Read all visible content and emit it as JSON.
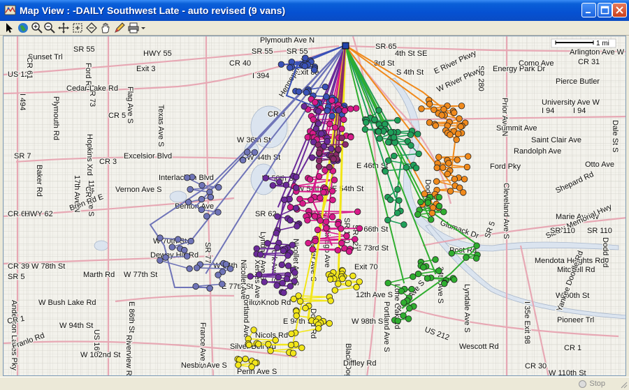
{
  "window": {
    "title": "Map View : -DAILY Southwest Late - auto revised (9 vans)"
  },
  "toolbar": {
    "tools": [
      "pointer-icon",
      "globe-icon",
      "zoom-in-icon",
      "zoom-out-icon",
      "pan-icon",
      "zoom-extent-icon",
      "zoom-previous-icon",
      "hand-icon",
      "draw-pencil-icon",
      "print-icon"
    ]
  },
  "scale": {
    "label": "1 mi"
  },
  "status": {
    "stop_label": "Stop"
  },
  "colors": {
    "blue": "#3a52b8",
    "magenta": "#d81a8a",
    "purple": "#6b2a9a",
    "slate": "#6f74b8",
    "orange": "#f08a1c",
    "green": "#1fa05a",
    "lime": "#2fae2f",
    "yellow": "#f2e61a",
    "depot": "#2244aa"
  },
  "map": {
    "labels": [
      "Plymouth Ave N",
      "Sunset Trl",
      "SR 55",
      "HWY 55",
      "SR 55",
      "SR 55",
      "CR 40",
      "I 394",
      "Exit 8a",
      "SR 65",
      "4th St SE",
      "Arlington Ave W",
      "US 12",
      "CR 61",
      "Ford Rd",
      "Exit 3",
      "3rd St",
      "S 4th St",
      "E River Pkwy",
      "SR 280",
      "Energy Park Dr",
      "Como Ave",
      "CR 31",
      "Pierce Butler",
      "Plymouth Rd",
      "CR 73",
      "Cedar Lake Rd",
      "Flag Ave S",
      "Texas Ave S",
      "Hennepin Ave",
      "W River Pkwy",
      "Prior Ave N",
      "University Ave W",
      "I 94",
      "I 94",
      "I 494",
      "Hopkins Xrd",
      "CR 5",
      "CR 3",
      "Summit Ave",
      "Dale St S",
      "SR 7",
      "Baker Rd",
      "17th Ave N",
      "11th Ave S",
      "CR 3",
      "Excelsior Blvd",
      "W 36th St",
      "W 44th St",
      "Saint Clair Ave",
      "Randolph Ave",
      "CR 7",
      "Interlachen Blvd",
      "W 50th St",
      "E 46th St",
      "Otto Ave",
      "Ford Pky",
      "Bren Rd E",
      "Vernon Ave S",
      "Benton Ave",
      "W 54th St",
      "E 54th St",
      "Cleveland Ave S",
      "Shepard Rd",
      "CR 62",
      "HWY 62",
      "SR 62",
      "SR 62",
      "Marie Ave W",
      "Sibley Memorial Hwy",
      "Glumack Dr",
      "SR 110",
      "SR 110",
      "SR 5",
      "Dodd Rd",
      "E 66th St",
      "W 70th St",
      "Dewey Hill Rd",
      "E 73rd St",
      "Post Rd",
      "34th Ave S",
      "Mendota Heights Rd",
      "CR 39",
      "SR 5",
      "W 78th St",
      "Marth Rd",
      "W 77th St",
      "W 84th St",
      "E 77th St",
      "Exit 70",
      "Mitchell Rd",
      "Anderson Lakes Pky",
      "W Bush Lake Rd",
      "E 86th St",
      "12th Ave S",
      "Lone Oak Rd",
      "W 90th St",
      "Pilot Knob Rd",
      "I 35e Exit 98",
      "Yankee Doodle Rd",
      "Pioneer Trl",
      "CR 1",
      "W 94th St",
      "E 94th St",
      "W 98th St",
      "Nicols Rd",
      "US 212",
      "Franlo Rd",
      "US 169",
      "Riverview Rd",
      "W 102nd St",
      "Silver Bell Rd",
      "Wescott Rd",
      "CR 1",
      "Nesbitt Ave S",
      "France Ave S",
      "Portland Ave",
      "Black Dog Rd E",
      "Diffley Rd",
      "CR 30",
      "W 110th St",
      "Penn Ave S",
      "Lyndale Ave S",
      "Nicollet Ave S",
      "Cedar Ave S",
      "Portland Ave S",
      "SR 100",
      "SR 77",
      "Park Ave S",
      "York Ave S",
      "Xerxes Ave S",
      "Nicollet Ave",
      "Chicago Ave",
      "SR 121",
      "Dodd Rd",
      "Lyndale Ave S",
      "Dodd Rd"
    ]
  }
}
